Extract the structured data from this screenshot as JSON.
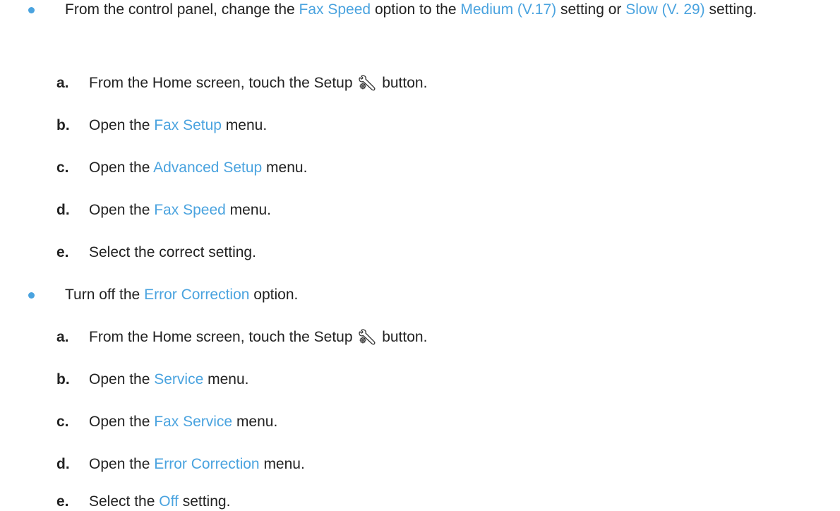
{
  "colors": {
    "accent": "#4aa3df",
    "text": "#222222"
  },
  "sections": [
    {
      "intro": {
        "pre": "From the control panel, change the ",
        "term1": "Fax Speed",
        "mid1": " option to the ",
        "term2": "Medium (V.17)",
        "mid2": " setting or ",
        "term3": "Slow (V. 29)",
        "post": " setting."
      },
      "steps": [
        {
          "letter": "a.",
          "pre": "From the Home screen, touch the Setup ",
          "icon": "setup-wrench-gear-icon",
          "post": " button."
        },
        {
          "letter": "b.",
          "pre": "Open the ",
          "term": "Fax Setup",
          "post": " menu."
        },
        {
          "letter": "c.",
          "pre": "Open the ",
          "term": "Advanced Setup",
          "post": " menu."
        },
        {
          "letter": "d.",
          "pre": "Open the ",
          "term": "Fax Speed",
          "post": " menu."
        },
        {
          "letter": "e.",
          "text": "Select the correct setting."
        }
      ]
    },
    {
      "intro": {
        "pre": "Turn off the ",
        "term1": "Error Correction",
        "post": " option."
      },
      "steps": [
        {
          "letter": "a.",
          "pre": "From the Home screen, touch the Setup ",
          "icon": "setup-wrench-gear-icon",
          "post": " button."
        },
        {
          "letter": "b.",
          "pre": "Open the ",
          "term": "Service",
          "post": " menu."
        },
        {
          "letter": "c.",
          "pre": "Open the ",
          "term": "Fax Service",
          "post": " menu."
        },
        {
          "letter": "d.",
          "pre": "Open the ",
          "term": "Error Correction",
          "post": " menu."
        },
        {
          "letter": "e.",
          "pre": "Select the ",
          "term": "Off",
          "post": " setting."
        }
      ]
    }
  ]
}
